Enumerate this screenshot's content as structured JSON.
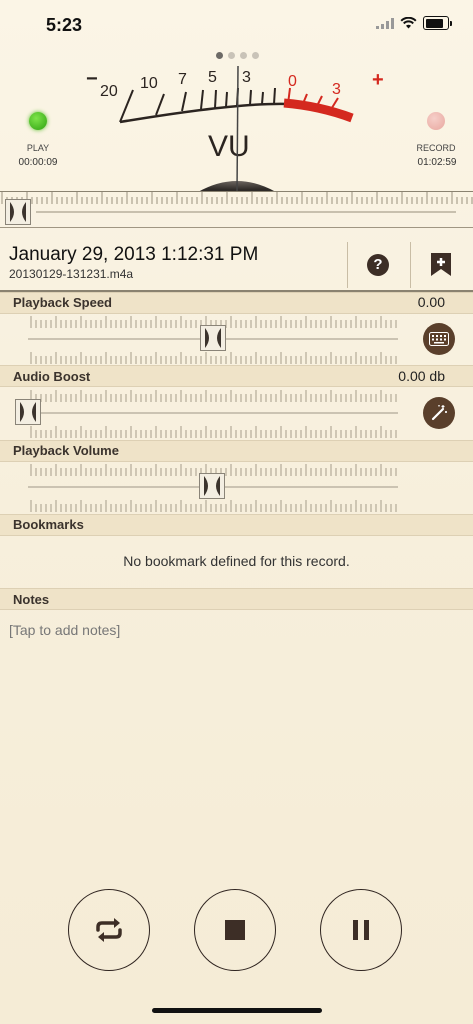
{
  "status": {
    "time": "5:23"
  },
  "meter": {
    "title": "VU",
    "minus_sign": "−",
    "plus_sign": "+",
    "scale_black": [
      "20",
      "10",
      "7",
      "5",
      "3"
    ],
    "scale_red": [
      "0",
      "3"
    ],
    "page_count": 4,
    "active_page": 0,
    "left": {
      "label": "PLAY",
      "time": "00:00:09",
      "led_color": "#3fb91c"
    },
    "right": {
      "label": "RECORD",
      "time": "01:02:59",
      "led_color": "#eeb6ae"
    }
  },
  "recording": {
    "title": "January 29, 2013 1:12:31 PM",
    "filename": "20130129-131231.m4a",
    "help_label": "?"
  },
  "playback_speed": {
    "label": "Playback Speed",
    "value": "0.00"
  },
  "audio_boost": {
    "label": "Audio Boost",
    "value": "0.00 db"
  },
  "playback_volume": {
    "label": "Playback Volume"
  },
  "bookmarks": {
    "label": "Bookmarks",
    "empty_text": "No bookmark defined for this record."
  },
  "notes": {
    "label": "Notes",
    "placeholder": "[Tap to add notes]"
  },
  "colors": {
    "accent_brown": "#5a3f2b",
    "meter_red": "#d4291f",
    "section_bg": "#efe3c8"
  }
}
